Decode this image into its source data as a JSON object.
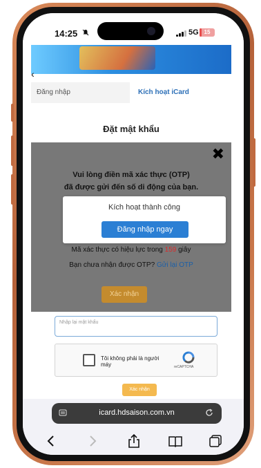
{
  "status_bar": {
    "time": "14:25",
    "network": "5G",
    "battery": "15",
    "battery_level": 0.15
  },
  "tabs": {
    "login": "Đăng nhập",
    "activate": "Kích hoạt iCard"
  },
  "page_title": "Đặt mật khẩu",
  "otp_dialog": {
    "message_line1": "Vui lòng điền mã xác thực (OTP)",
    "message_line2": "đã được gửi đến số di động của bạn.",
    "validity_prefix": "Mã xác thực có hiệu lực trong ",
    "validity_seconds": "159",
    "validity_suffix": " giây",
    "resend_prompt": "Bạn chưa nhận được OTP? ",
    "resend_link": "Gửi lại OTP",
    "submit": "Xác nhận"
  },
  "success_modal": {
    "text": "Kích hoạt thành công",
    "button": "Đăng nhập ngay"
  },
  "form": {
    "confirm_password_placeholder": "Nhập lại mật khẩu",
    "recaptcha_label": "Tôi không phải là người máy",
    "recaptcha_brand": "reCAPTCHA",
    "submit": "Xác nhận"
  },
  "safari": {
    "url": "icard.hdsaison.com.vn"
  },
  "colors": {
    "accent": "#2b7fd4",
    "warning": "#f4b94f",
    "link": "#1b5fa8"
  }
}
